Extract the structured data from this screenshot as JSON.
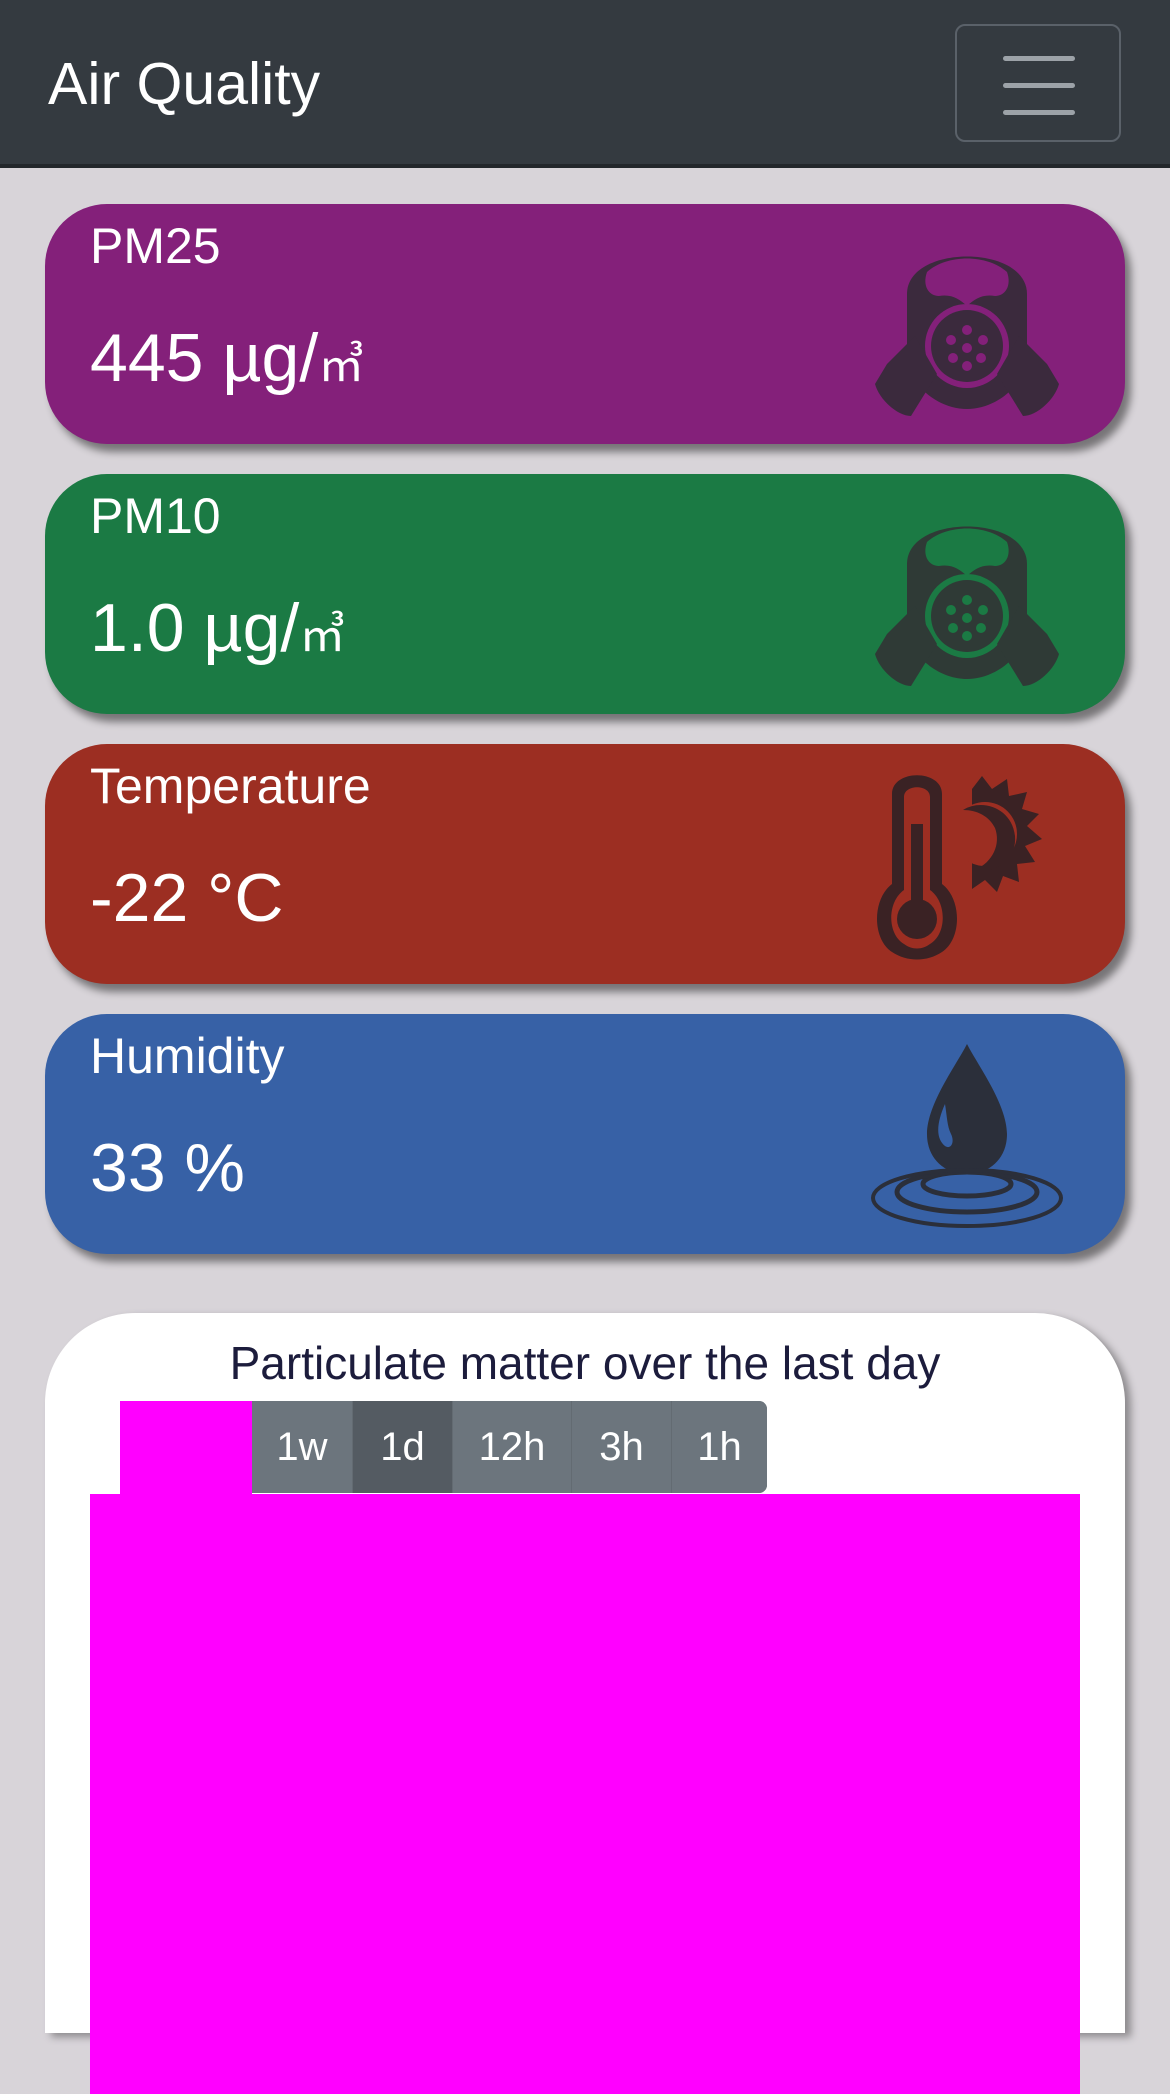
{
  "navbar": {
    "brand": "Air Quality",
    "menu_icon": "hamburger-menu-icon"
  },
  "cards": [
    {
      "title": "PM25",
      "value": "445 µg/",
      "unit": "㎥",
      "color": "#84207a",
      "icon": "gas-mask-icon"
    },
    {
      "title": "PM10",
      "value": "1.0 µg/",
      "unit": "㎥",
      "color": "#1b7a44",
      "icon": "gas-mask-icon"
    },
    {
      "title": "Temperature",
      "value": "-22 °C",
      "unit": "",
      "color": "#9c2e22",
      "icon": "thermometer-sun-icon"
    },
    {
      "title": "Humidity",
      "value": "33 %",
      "unit": "",
      "color": "#3761a6",
      "icon": "water-drop-icon"
    }
  ],
  "chart": {
    "title": "Particulate matter over the last day",
    "range_buttons": [
      "1w",
      "1d",
      "12h",
      "3h",
      "1h"
    ],
    "active_range": "1d",
    "placeholder_color": "#ff00ff"
  }
}
